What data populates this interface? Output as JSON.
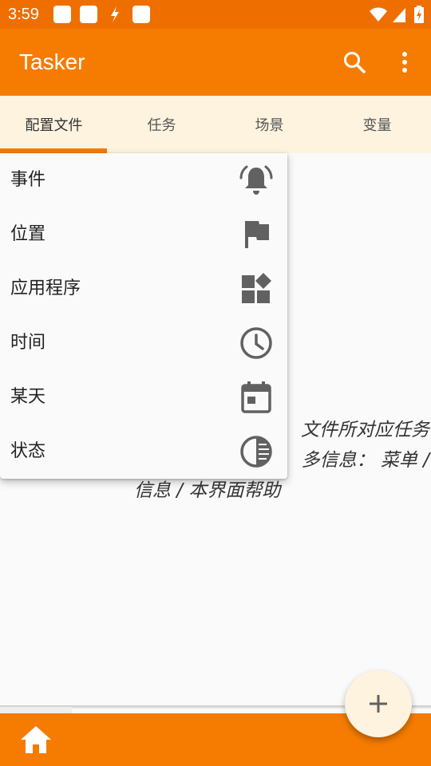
{
  "status_bar": {
    "time": "3:59"
  },
  "app_bar": {
    "title": "Tasker",
    "search_icon": "search-icon",
    "more_icon": "more-vert-icon"
  },
  "tabs": [
    {
      "label": "配置文件",
      "active": true
    },
    {
      "label": "任务",
      "active": false
    },
    {
      "label": "场景",
      "active": false
    },
    {
      "label": "变量",
      "active": false
    }
  ],
  "hint_text": {
    "line1": "文件所对应任务",
    "line2": "多信息：  菜单 /",
    "line3": "信息 / 本界面帮助"
  },
  "menu": {
    "items": [
      {
        "label": "事件",
        "icon": "bell-icon"
      },
      {
        "label": "位置",
        "icon": "flag-icon"
      },
      {
        "label": "应用程序",
        "icon": "widgets-icon"
      },
      {
        "label": "时间",
        "icon": "clock-icon"
      },
      {
        "label": "某天",
        "icon": "calendar-icon"
      },
      {
        "label": "状态",
        "icon": "contrast-icon"
      }
    ]
  },
  "fab": {
    "icon": "plus-icon"
  },
  "bottom_bar": {
    "icon": "home-icon"
  },
  "colors": {
    "status_bar": "#ee6f00",
    "primary": "#f57c00",
    "tab_background": "#fdf3df",
    "icon_gray": "#616161"
  }
}
